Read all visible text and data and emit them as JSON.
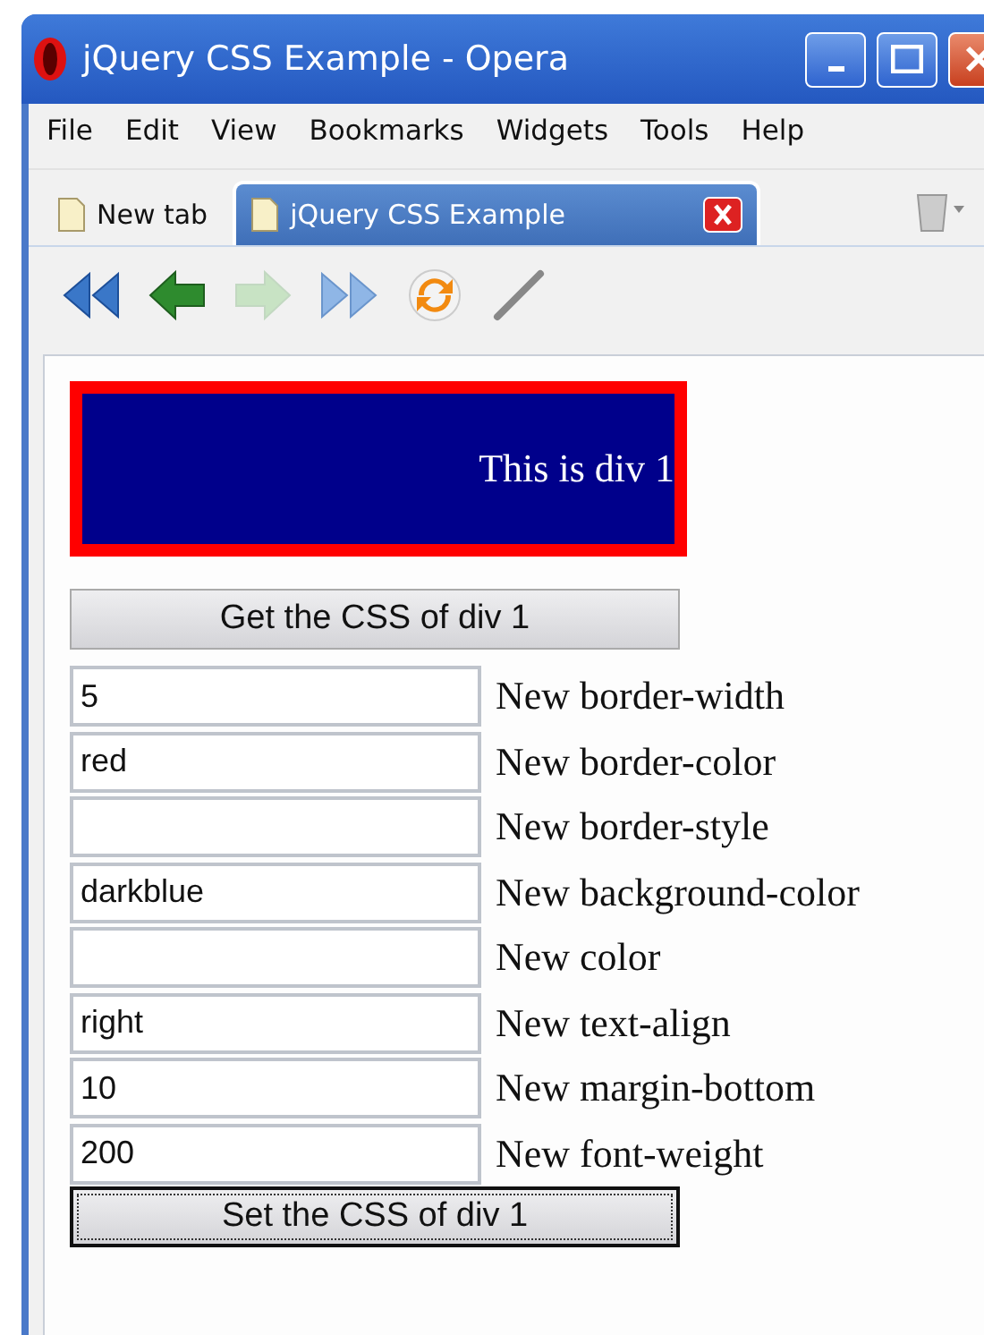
{
  "window": {
    "title": "jQuery CSS Example - Opera"
  },
  "menu": [
    "File",
    "Edit",
    "View",
    "Bookmarks",
    "Widgets",
    "Tools",
    "Help"
  ],
  "tabs": [
    {
      "label": "New tab",
      "selected": false
    },
    {
      "label": "jQuery CSS Example",
      "selected": true
    }
  ],
  "toolbar": [
    {
      "kind": "rewind",
      "disabled": false
    },
    {
      "kind": "back",
      "disabled": false
    },
    {
      "kind": "forward",
      "disabled": true
    },
    {
      "kind": "fastforward",
      "disabled": false
    },
    {
      "kind": "reload",
      "disabled": false
    },
    {
      "kind": "wand",
      "disabled": false
    }
  ],
  "div1": {
    "text": "This is div 1"
  },
  "get_button": {
    "label": "Get the CSS of div 1",
    "focused": false
  },
  "fields": [
    {
      "value": "5",
      "label": "New border-width"
    },
    {
      "value": "red",
      "label": "New border-color"
    },
    {
      "label": "New border-style"
    },
    {
      "value": "darkblue",
      "label": "New background-color"
    },
    {
      "label": "New color"
    },
    {
      "value": "right",
      "label": "New text-align"
    },
    {
      "value": "10",
      "label": "New margin-bottom"
    },
    {
      "value": "200",
      "label": "New font-weight"
    }
  ],
  "set_button": {
    "label": "Set the CSS of div 1",
    "focused": true
  }
}
